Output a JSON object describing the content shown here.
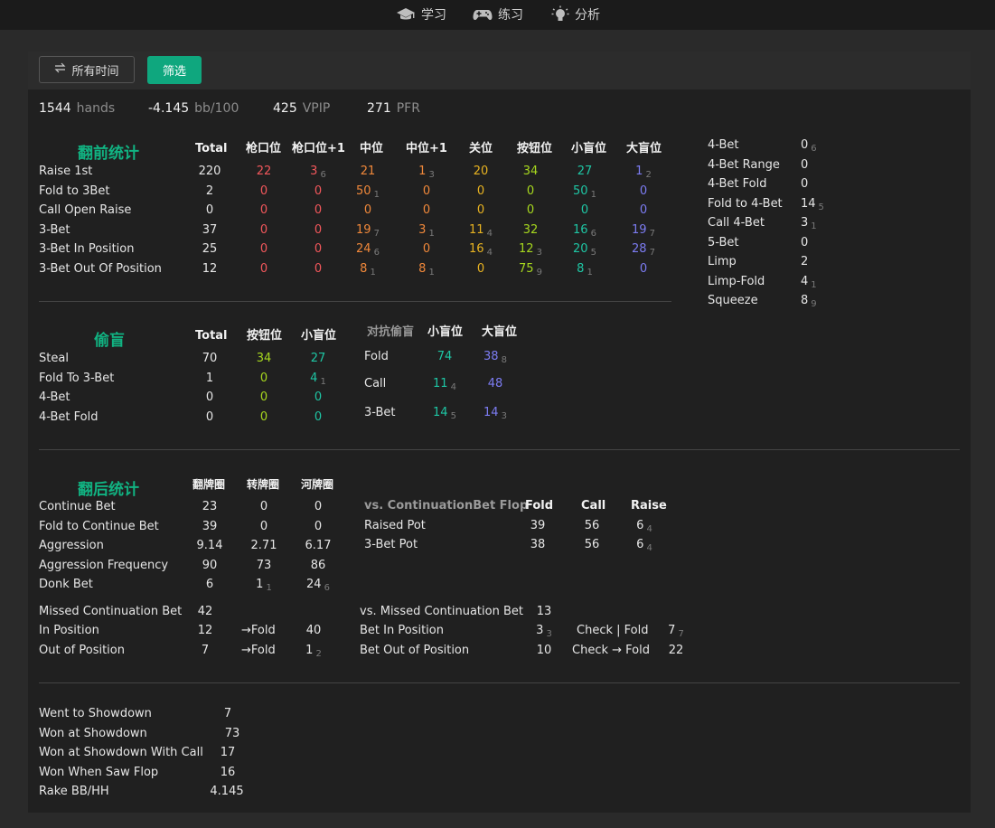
{
  "nav": {
    "learn": "学习",
    "practice": "练习",
    "analyze": "分析"
  },
  "toolbar": {
    "time_label": "所有时间",
    "filter_label": "筛选"
  },
  "summary": {
    "hands_value": "1544",
    "hands_unit": "hands",
    "bb100_value": "-4.145",
    "bb100_unit": "bb/100",
    "vpip_value": "425",
    "vpip_unit": "VPIP",
    "pfr_value": "271",
    "pfr_unit": "PFR"
  },
  "colors": {
    "accent": "#0fa77e",
    "red": "#f2575b",
    "orange": "#f0883a",
    "yellow": "#e8b321",
    "lime": "#a6d71e",
    "teal": "#1ec6a4",
    "blue": "#7c7cf2"
  },
  "preflop": {
    "title": "翻前统计",
    "headers": [
      "Total",
      "枪口位",
      "枪口位+1",
      "中位",
      "中位+1",
      "关位",
      "按钮位",
      "小盲位",
      "大盲位"
    ],
    "rows": [
      {
        "label": "Raise 1st",
        "cells": [
          {
            "v": "220",
            "s": ""
          },
          {
            "v": "22",
            "s": ""
          },
          {
            "v": "3",
            "s": "6"
          },
          {
            "v": "21",
            "s": ""
          },
          {
            "v": "1",
            "s": "3"
          },
          {
            "v": "20",
            "s": ""
          },
          {
            "v": "34",
            "s": ""
          },
          {
            "v": "27",
            "s": ""
          },
          {
            "v": "1",
            "s": "2"
          }
        ]
      },
      {
        "label": "Fold to 3Bet",
        "cells": [
          {
            "v": "2",
            "s": ""
          },
          {
            "v": "0",
            "s": ""
          },
          {
            "v": "0",
            "s": ""
          },
          {
            "v": "50",
            "s": "1"
          },
          {
            "v": "0",
            "s": ""
          },
          {
            "v": "0",
            "s": ""
          },
          {
            "v": "0",
            "s": ""
          },
          {
            "v": "50",
            "s": "1"
          },
          {
            "v": "0",
            "s": ""
          }
        ]
      },
      {
        "label": "Call Open Raise",
        "cells": [
          {
            "v": "0",
            "s": ""
          },
          {
            "v": "0",
            "s": ""
          },
          {
            "v": "0",
            "s": ""
          },
          {
            "v": "0",
            "s": ""
          },
          {
            "v": "0",
            "s": ""
          },
          {
            "v": "0",
            "s": ""
          },
          {
            "v": "0",
            "s": ""
          },
          {
            "v": "0",
            "s": ""
          },
          {
            "v": "0",
            "s": ""
          }
        ]
      },
      {
        "label": "3-Bet",
        "cells": [
          {
            "v": "37",
            "s": ""
          },
          {
            "v": "0",
            "s": ""
          },
          {
            "v": "0",
            "s": ""
          },
          {
            "v": "19",
            "s": "7"
          },
          {
            "v": "3",
            "s": "1"
          },
          {
            "v": "11",
            "s": "4"
          },
          {
            "v": "32",
            "s": ""
          },
          {
            "v": "16",
            "s": "6"
          },
          {
            "v": "19",
            "s": "7"
          }
        ]
      },
      {
        "label": "3-Bet In Position",
        "cells": [
          {
            "v": "25",
            "s": ""
          },
          {
            "v": "0",
            "s": ""
          },
          {
            "v": "0",
            "s": ""
          },
          {
            "v": "24",
            "s": "6"
          },
          {
            "v": "0",
            "s": ""
          },
          {
            "v": "16",
            "s": "4"
          },
          {
            "v": "12",
            "s": "3"
          },
          {
            "v": "20",
            "s": "5"
          },
          {
            "v": "28",
            "s": "7"
          }
        ]
      },
      {
        "label": "3-Bet Out Of Position",
        "cells": [
          {
            "v": "12",
            "s": ""
          },
          {
            "v": "0",
            "s": ""
          },
          {
            "v": "0",
            "s": ""
          },
          {
            "v": "8",
            "s": "1"
          },
          {
            "v": "8",
            "s": "1"
          },
          {
            "v": "0",
            "s": ""
          },
          {
            "v": "75",
            "s": "9"
          },
          {
            "v": "8",
            "s": "1"
          },
          {
            "v": "0",
            "s": ""
          }
        ]
      }
    ]
  },
  "side_stats": [
    {
      "label": "4-Bet",
      "v": "0",
      "s": "6"
    },
    {
      "label": "4-Bet Range",
      "v": "0",
      "s": ""
    },
    {
      "label": "4-Bet Fold",
      "v": "0",
      "s": ""
    },
    {
      "label": "Fold to 4-Bet",
      "v": "14",
      "s": "5"
    },
    {
      "label": "Call 4-Bet",
      "v": "3",
      "s": "1"
    },
    {
      "label": "5-Bet",
      "v": "0",
      "s": ""
    },
    {
      "label": "Limp",
      "v": "2",
      "s": ""
    },
    {
      "label": "Limp-Fold",
      "v": "4",
      "s": "1"
    },
    {
      "label": "Squeeze",
      "v": "8",
      "s": "9"
    }
  ],
  "steal": {
    "title": "偷盲",
    "headers": [
      "Total",
      "按钮位",
      "小盲位"
    ],
    "rows": [
      {
        "label": "Steal",
        "cells": [
          {
            "v": "70",
            "s": ""
          },
          {
            "v": "34",
            "s": ""
          },
          {
            "v": "27",
            "s": ""
          }
        ]
      },
      {
        "label": "Fold To 3-Bet",
        "cells": [
          {
            "v": "1",
            "s": ""
          },
          {
            "v": "0",
            "s": ""
          },
          {
            "v": "4",
            "s": "1"
          }
        ]
      },
      {
        "label": "4-Bet",
        "cells": [
          {
            "v": "0",
            "s": ""
          },
          {
            "v": "0",
            "s": ""
          },
          {
            "v": "0",
            "s": ""
          }
        ]
      },
      {
        "label": "4-Bet Fold",
        "cells": [
          {
            "v": "0",
            "s": ""
          },
          {
            "v": "0",
            "s": ""
          },
          {
            "v": "0",
            "s": ""
          }
        ]
      }
    ]
  },
  "vs_steal": {
    "title": "对抗偷盲",
    "headers": [
      "小盲位",
      "大盲位"
    ],
    "rows": [
      {
        "label": "Fold",
        "cells": [
          {
            "v": "74",
            "s": ""
          },
          {
            "v": "38",
            "s": "8"
          }
        ]
      },
      {
        "label": "Call",
        "cells": [
          {
            "v": "11",
            "s": "4"
          },
          {
            "v": "48",
            "s": ""
          }
        ]
      },
      {
        "label": "3-Bet",
        "cells": [
          {
            "v": "14",
            "s": "5"
          },
          {
            "v": "14",
            "s": "3"
          }
        ]
      }
    ]
  },
  "postflop": {
    "title": "翻后统计",
    "headers": [
      "翻牌圈",
      "转牌圈",
      "河牌圈"
    ],
    "rows": [
      {
        "label": "Continue Bet",
        "cells": [
          {
            "v": "23",
            "s": ""
          },
          {
            "v": "0",
            "s": ""
          },
          {
            "v": "0",
            "s": ""
          }
        ]
      },
      {
        "label": "Fold to Continue Bet",
        "cells": [
          {
            "v": "39",
            "s": ""
          },
          {
            "v": "0",
            "s": ""
          },
          {
            "v": "0",
            "s": ""
          }
        ]
      },
      {
        "label": "Aggression",
        "cells": [
          {
            "v": "9.14",
            "s": ""
          },
          {
            "v": "2.71",
            "s": ""
          },
          {
            "v": "6.17",
            "s": ""
          }
        ]
      },
      {
        "label": "Aggression Frequency",
        "cells": [
          {
            "v": "90",
            "s": ""
          },
          {
            "v": "73",
            "s": ""
          },
          {
            "v": "86",
            "s": ""
          }
        ]
      },
      {
        "label": "Donk Bet",
        "cells": [
          {
            "v": "6",
            "s": ""
          },
          {
            "v": "1",
            "s": "1"
          },
          {
            "v": "24",
            "s": "6"
          }
        ]
      }
    ]
  },
  "vs_cbet": {
    "title": "vs. ContinuationBet Flop",
    "headers": [
      "Fold",
      "Call",
      "Raise"
    ],
    "rows": [
      {
        "label": "Raised Pot",
        "cells": [
          {
            "v": "39",
            "s": ""
          },
          {
            "v": "56",
            "s": ""
          },
          {
            "v": "6",
            "s": "4"
          }
        ]
      },
      {
        "label": "3-Bet Pot",
        "cells": [
          {
            "v": "38",
            "s": ""
          },
          {
            "v": "56",
            "s": ""
          },
          {
            "v": "6",
            "s": "4"
          }
        ]
      }
    ]
  },
  "missed_cbet": {
    "title": "Missed Continuation Bet",
    "title_v": "42",
    "rows": [
      {
        "label": "In Position",
        "v": "12",
        "arrow": "→Fold",
        "v2": "40",
        "s2": ""
      },
      {
        "label": "Out of Position",
        "v": "7",
        "arrow": "→Fold",
        "v2": "1",
        "s2": "2"
      }
    ]
  },
  "vs_missed_cbet": {
    "title": "vs. Missed Continuation Bet",
    "title_v": "13",
    "rows": [
      {
        "label": "Bet In Position",
        "v": "3",
        "s": "3",
        "action": "Check | Fold",
        "v2": "7",
        "s2": "7"
      },
      {
        "label": "Bet Out of Position",
        "v": "10",
        "s": "",
        "action": "Check → Fold",
        "v2": "22",
        "s2": ""
      }
    ]
  },
  "showdown": [
    {
      "label": "Went to Showdown",
      "v": "7"
    },
    {
      "label": "Won at Showdown",
      "v": "73"
    },
    {
      "label": "Won at Showdown With Call",
      "v": "17"
    },
    {
      "label": "Won When Saw Flop",
      "v": "16"
    },
    {
      "label": "Rake BB/HH",
      "v": "4.145"
    }
  ]
}
